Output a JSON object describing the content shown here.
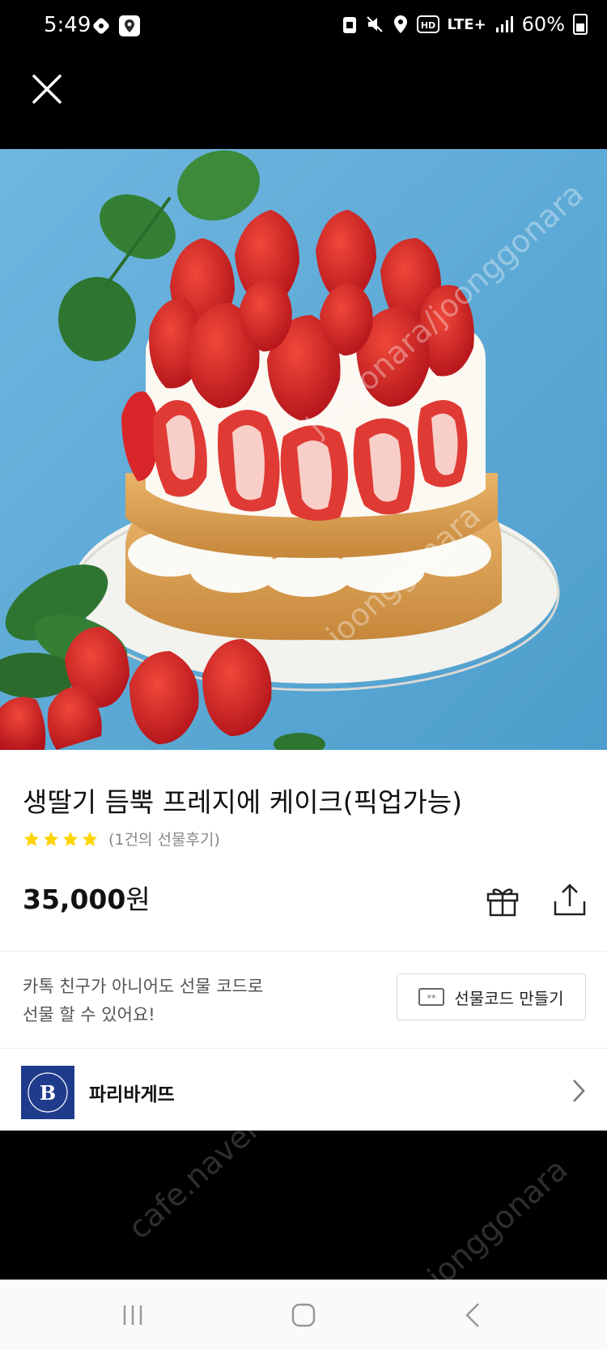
{
  "status_bar": {
    "time": "5:49",
    "network": "LTE+",
    "battery": "60%"
  },
  "top_bar": {
    "close_icon": "close-icon"
  },
  "hero": {
    "watermark_1": "jungonara/joonggonara",
    "watermark_2": "joonggonara",
    "watermark_3": "cafe.naver",
    "watermark_4": "jonggonara"
  },
  "product": {
    "title": "생딸기 듬뿍 프레지에 케이크(픽업가능)",
    "rating_stars": 4,
    "review_count": "(1건의 선물후기)",
    "price_number": "35,000",
    "price_unit": "원"
  },
  "promo": {
    "line1": "카톡 친구가 아니어도 선물 코드로",
    "line2": "선물 할 수 있어요!",
    "code_button_label": "선물코드 만들기"
  },
  "seller": {
    "name": "파리바게뜨",
    "logo_letter": "B"
  },
  "colors": {
    "star": "#FFD400",
    "sky": "#5AA9D6",
    "seller_logo": "#1F3C8C"
  }
}
